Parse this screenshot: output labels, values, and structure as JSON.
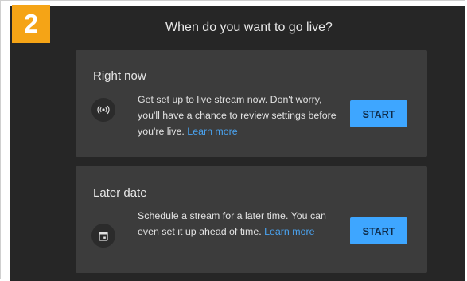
{
  "step_badge": "2",
  "dialog": {
    "title": "When do you want to go live?"
  },
  "options": [
    {
      "title": "Right now",
      "icon": "broadcast-icon",
      "description": "Get set up to live stream now. Don't worry, you'll have a chance to review settings before you're live.",
      "link": "Learn more",
      "button": "START"
    },
    {
      "title": "Later date",
      "icon": "calendar-icon",
      "description": "Schedule a stream for a later time. You can even set it up ahead of time.",
      "link": "Learn more",
      "button": "START"
    }
  ],
  "colors": {
    "badge": "#f5a416",
    "dialog_bg": "#262626",
    "card_bg": "#3c3c3c",
    "button": "#3ea6ff",
    "link": "#4aa3f0"
  }
}
